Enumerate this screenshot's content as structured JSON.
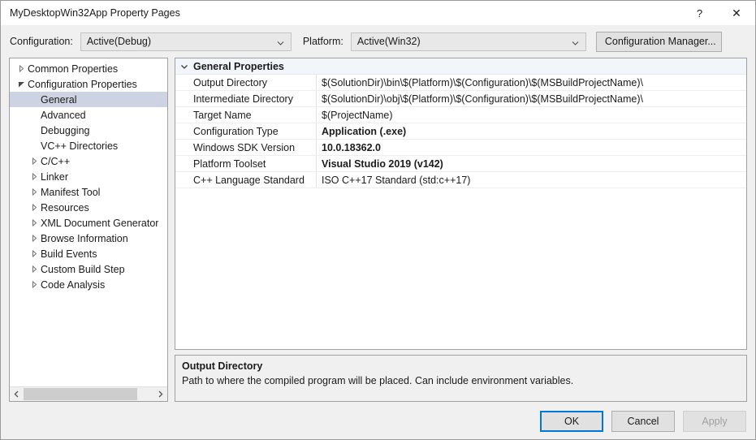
{
  "window": {
    "title": "MyDesktopWin32App Property Pages",
    "help_label": "?",
    "close_label": "✕"
  },
  "config_bar": {
    "configuration_label": "Configuration:",
    "configuration_value": "Active(Debug)",
    "platform_label": "Platform:",
    "platform_value": "Active(Win32)",
    "configuration_manager_label": "Configuration Manager..."
  },
  "tree": {
    "items": [
      {
        "label": "Common Properties",
        "level": 0,
        "expander": "collapsed",
        "selected": false
      },
      {
        "label": "Configuration Properties",
        "level": 0,
        "expander": "expanded",
        "selected": false
      },
      {
        "label": "General",
        "level": 1,
        "expander": "none",
        "selected": true
      },
      {
        "label": "Advanced",
        "level": 1,
        "expander": "none",
        "selected": false
      },
      {
        "label": "Debugging",
        "level": 1,
        "expander": "none",
        "selected": false
      },
      {
        "label": "VC++ Directories",
        "level": 1,
        "expander": "none",
        "selected": false
      },
      {
        "label": "C/C++",
        "level": 1,
        "expander": "collapsed",
        "selected": false
      },
      {
        "label": "Linker",
        "level": 1,
        "expander": "collapsed",
        "selected": false
      },
      {
        "label": "Manifest Tool",
        "level": 1,
        "expander": "collapsed",
        "selected": false
      },
      {
        "label": "Resources",
        "level": 1,
        "expander": "collapsed",
        "selected": false
      },
      {
        "label": "XML Document Generator",
        "level": 1,
        "expander": "collapsed",
        "selected": false
      },
      {
        "label": "Browse Information",
        "level": 1,
        "expander": "collapsed",
        "selected": false
      },
      {
        "label": "Build Events",
        "level": 1,
        "expander": "collapsed",
        "selected": false
      },
      {
        "label": "Custom Build Step",
        "level": 1,
        "expander": "collapsed",
        "selected": false
      },
      {
        "label": "Code Analysis",
        "level": 1,
        "expander": "collapsed",
        "selected": false
      }
    ],
    "scrollbar": {
      "left_arrow": "‹",
      "right_arrow": "›"
    }
  },
  "grid": {
    "category": "General Properties",
    "rows": [
      {
        "name": "Output Directory",
        "value": "$(SolutionDir)\\bin\\$(Platform)\\$(Configuration)\\$(MSBuildProjectName)\\",
        "bold": false
      },
      {
        "name": "Intermediate Directory",
        "value": "$(SolutionDir)\\obj\\$(Platform)\\$(Configuration)\\$(MSBuildProjectName)\\",
        "bold": false
      },
      {
        "name": "Target Name",
        "value": "$(ProjectName)",
        "bold": false
      },
      {
        "name": "Configuration Type",
        "value": "Application (.exe)",
        "bold": true
      },
      {
        "name": "Windows SDK Version",
        "value": "10.0.18362.0",
        "bold": true
      },
      {
        "name": "Platform Toolset",
        "value": "Visual Studio 2019 (v142)",
        "bold": true
      },
      {
        "name": "C++ Language Standard",
        "value": "ISO C++17 Standard (std:c++17)",
        "bold": false
      }
    ]
  },
  "description": {
    "title": "Output Directory",
    "text": "Path to where the compiled program will be placed. Can include environment variables."
  },
  "footer": {
    "ok_label": "OK",
    "cancel_label": "Cancel",
    "apply_label": "Apply"
  },
  "colors": {
    "accent": "#0078d7",
    "selection": "#cdd3e3",
    "category_bg": "#f2f5fa",
    "dialog_bg": "#f0f0f0"
  }
}
